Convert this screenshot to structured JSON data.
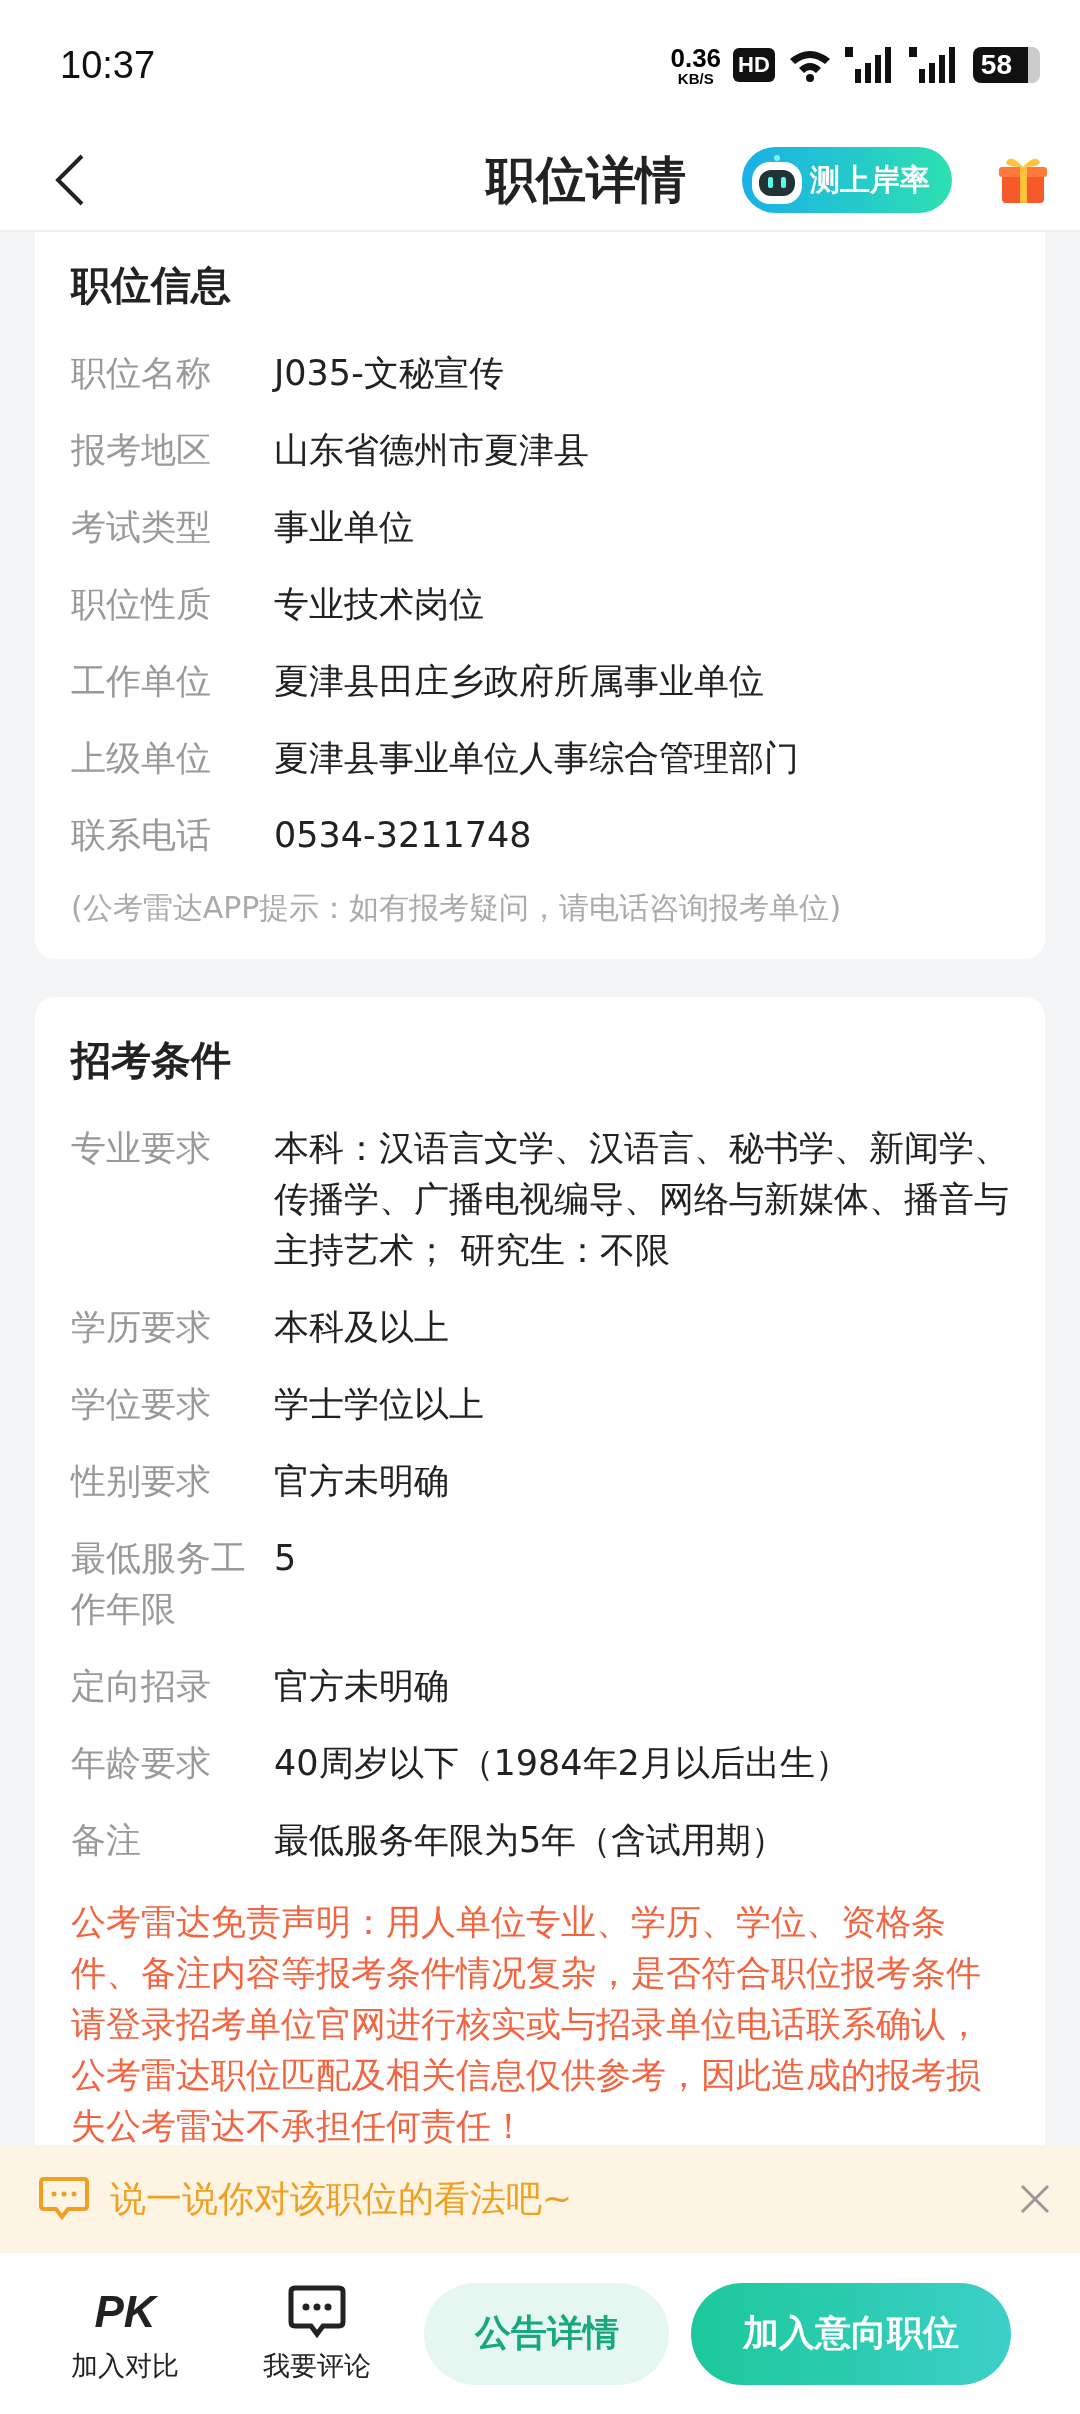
{
  "status_bar": {
    "time": "10:37",
    "net_speed": "0.36",
    "net_unit": "KB/S",
    "hd": "HD",
    "battery": "58"
  },
  "header": {
    "title": "职位详情",
    "badge": "测上岸率"
  },
  "position_info": {
    "title": "职位信息",
    "rows": [
      {
        "label": "职位名称",
        "value": "J035-文秘宣传"
      },
      {
        "label": "报考地区",
        "value": "山东省德州市夏津县"
      },
      {
        "label": "考试类型",
        "value": "事业单位"
      },
      {
        "label": "职位性质",
        "value": "专业技术岗位"
      },
      {
        "label": "工作单位",
        "value": "夏津县田庄乡政府所属事业单位"
      },
      {
        "label": "上级单位",
        "value": "夏津县事业单位人事综合管理部门"
      },
      {
        "label": "联系电话",
        "value": "0534-3211748"
      }
    ],
    "hint": "(公考雷达APP提示：如有报考疑问，请电话咨询报考单位)"
  },
  "requirements": {
    "title": "招考条件",
    "rows": [
      {
        "label": "专业要求",
        "value": "本科：汉语言文学、汉语言、秘书学、新闻学、传播学、广播电视编导、网络与新媒体、播音与主持艺术；  研究生：不限"
      },
      {
        "label": "学历要求",
        "value": "本科及以上"
      },
      {
        "label": "学位要求",
        "value": "学士学位以上"
      },
      {
        "label": "性别要求",
        "value": "官方未明确"
      },
      {
        "label": "最低服务工作年限",
        "value": "5"
      },
      {
        "label": "定向招录",
        "value": "官方未明确"
      },
      {
        "label": "年龄要求",
        "value": "40周岁以下（1984年2月以后出生）"
      },
      {
        "label": "备注",
        "value": "最低服务年限为5年（含试用期）"
      }
    ],
    "disclaimer": "公考雷达免责声明：用人单位专业、学历、学位、资格条件、备注内容等报考条件情况复杂，是否符合职位报考条件请登录招考单位官网进行核实或与招录单位电话联系确认，公考雷达职位匹配及相关信息仅供参考，因此造成的报考损失公考雷达不承担任何责任！"
  },
  "comment_banner": {
    "text": "说一说你对该职位的看法吧~"
  },
  "bottom_bar": {
    "compare_icon": "PK",
    "compare": "加入对比",
    "comment": "我要评论",
    "notice_button": "公告详情",
    "add_button": "加入意向职位"
  }
}
